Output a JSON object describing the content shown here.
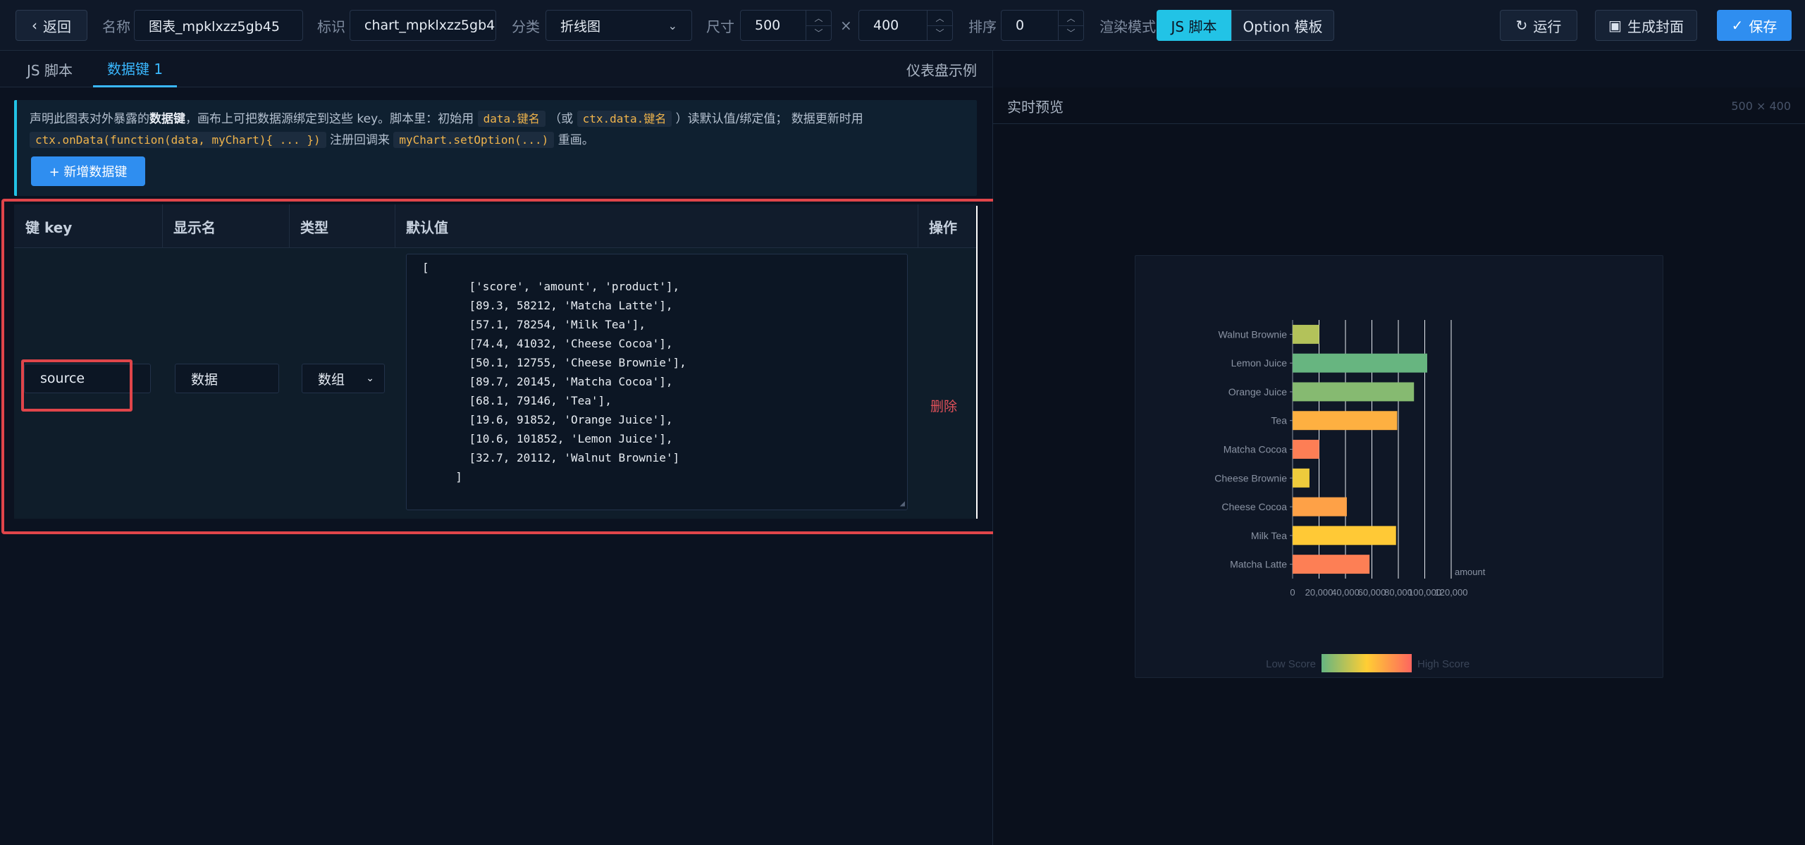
{
  "toolbar": {
    "back_label": "返回",
    "name_label": "名称",
    "name_value": "图表_mpklxzz5gb45",
    "id_label": "标识",
    "id_value": "chart_mpklxzz5gb45",
    "category_label": "分类",
    "category_value": "折线图",
    "size_label": "尺寸",
    "width_value": "500",
    "times": "×",
    "height_value": "400",
    "order_label": "排序",
    "order_value": "0",
    "render_label": "渲染模式",
    "mode_js": "JS 脚本",
    "mode_option": "Option 模板",
    "run_label": "运行",
    "cover_label": "生成封面",
    "save_label": "保存"
  },
  "tabs": [
    {
      "label": "JS 脚本"
    },
    {
      "label": "数据键 1"
    }
  ],
  "dashboard_example": "仪表盘示例",
  "preview": {
    "title": "实时预览",
    "size": "500 × 400"
  },
  "info": {
    "line1_a": "声明此图表对外暴露的",
    "line1_bold": "数据键",
    "line1_b": "，画布上可把数据源绑定到这些 key。脚本里：初始用",
    "code1": "data.键名",
    "line1_c": "（或",
    "code2": "ctx.data.键名",
    "line1_d": "）读默认值/绑定值； 数据更新时用",
    "code3": "ctx.onData(function(data, myChart){ ... })",
    "line2_a": "注册回调来",
    "code4": "myChart.setOption(...)",
    "line2_b": "重画。",
    "add_button": "+ 新增数据键"
  },
  "table": {
    "headers": [
      "键 key",
      "显示名",
      "类型",
      "默认值",
      "操作"
    ],
    "row": {
      "key": "source",
      "display": "数据",
      "type": "数组",
      "action": "删除",
      "default_lines": [
        "[",
        "    ['score', 'amount', 'product'],",
        "    [89.3, 58212, 'Matcha Latte'],",
        "    [57.1, 78254, 'Milk Tea'],",
        "    [74.4, 41032, 'Cheese Cocoa'],",
        "    [50.1, 12755, 'Cheese Brownie'],",
        "    [89.7, 20145, 'Matcha Cocoa'],",
        "    [68.1, 79146, 'Tea'],",
        "    [19.6, 91852, 'Orange Juice'],",
        "    [10.6, 101852, 'Lemon Juice'],",
        "    [32.7, 20112, 'Walnut Brownie']",
        "  ]"
      ]
    }
  },
  "chart_data": {
    "type": "bar",
    "orientation": "horizontal",
    "categories": [
      "Matcha Latte",
      "Milk Tea",
      "Cheese Cocoa",
      "Cheese Brownie",
      "Matcha Cocoa",
      "Tea",
      "Orange Juice",
      "Lemon Juice",
      "Walnut Brownie"
    ],
    "values": [
      58212,
      78254,
      41032,
      12755,
      20145,
      79146,
      91852,
      101852,
      20112
    ],
    "scores": [
      89.3,
      57.1,
      74.4,
      50.1,
      89.7,
      68.1,
      19.6,
      10.6,
      32.7
    ],
    "xlabel": "amount",
    "xlim": [
      0,
      120000
    ],
    "xticks": [
      "0",
      "20,000",
      "40,000",
      "60,000",
      "80,000",
      "100,000",
      "120,000"
    ],
    "grid": true,
    "visual_map": {
      "low_label": "Low Score",
      "high_label": "High Score",
      "min": 10,
      "max": 100,
      "colors": [
        "#65B581",
        "#FFCE34",
        "#FD665F"
      ]
    }
  }
}
